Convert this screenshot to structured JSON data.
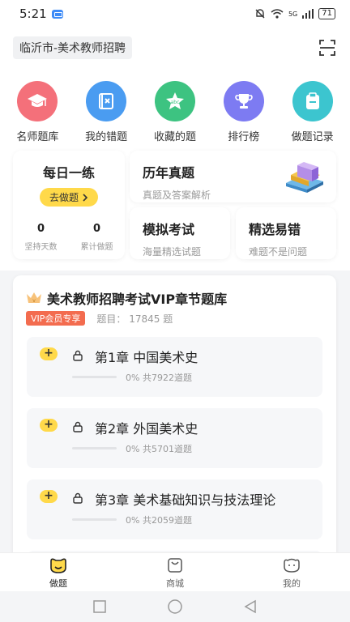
{
  "status_bar": {
    "time": "5:21",
    "network": "5G",
    "battery": "71"
  },
  "header": {
    "city_title": "临沂市-美术教师招聘"
  },
  "quick_actions": [
    {
      "label": "名师题库",
      "icon": "graduation-cap-icon",
      "color": "#f4707a"
    },
    {
      "label": "我的错题",
      "icon": "notebook-x-icon",
      "color": "#4a9cf1"
    },
    {
      "label": "收藏的题",
      "icon": "star-abc-icon",
      "color": "#3dc381"
    },
    {
      "label": "排行榜",
      "icon": "trophy-icon",
      "color": "#7d7bf2"
    },
    {
      "label": "做题记录",
      "icon": "clipboard-icon",
      "color": "#3cc5cf"
    }
  ],
  "daily_practice": {
    "title": "每日一练",
    "button": "去做题",
    "stats": [
      {
        "value": "0",
        "label": "坚持天数"
      },
      {
        "value": "0",
        "label": "累计做题"
      }
    ]
  },
  "past_exam": {
    "title": "历年真题",
    "subtitle": "真题及答案解析"
  },
  "mock_exam": {
    "title": "模拟考试",
    "subtitle": "海量精选试题"
  },
  "picked_errors": {
    "title": "精选易错",
    "subtitle": "难题不是问题"
  },
  "vip_bank": {
    "title": "美术教师招聘考试VIP章节题库",
    "badge": "VIP会员专享",
    "count": "题目： 17845 题",
    "chapters": [
      {
        "title": "第1章 中国美术史",
        "progress_text": "0% 共7922道题",
        "progress": 0
      },
      {
        "title": "第2章 外国美术史",
        "progress_text": "0% 共5701道题",
        "progress": 0
      },
      {
        "title": "第3章 美术基础知识与技法理论",
        "progress_text": "0% 共2059道题",
        "progress": 0
      }
    ]
  },
  "tab_bar": [
    {
      "label": "做题",
      "icon": "practice-face-icon",
      "active": true
    },
    {
      "label": "商城",
      "icon": "shopping-bag-icon",
      "active": false
    },
    {
      "label": "我的",
      "icon": "profile-face-icon",
      "active": false
    }
  ],
  "colors": {
    "accent_yellow": "#ffd94a",
    "vip_red": "#f36c4f"
  }
}
